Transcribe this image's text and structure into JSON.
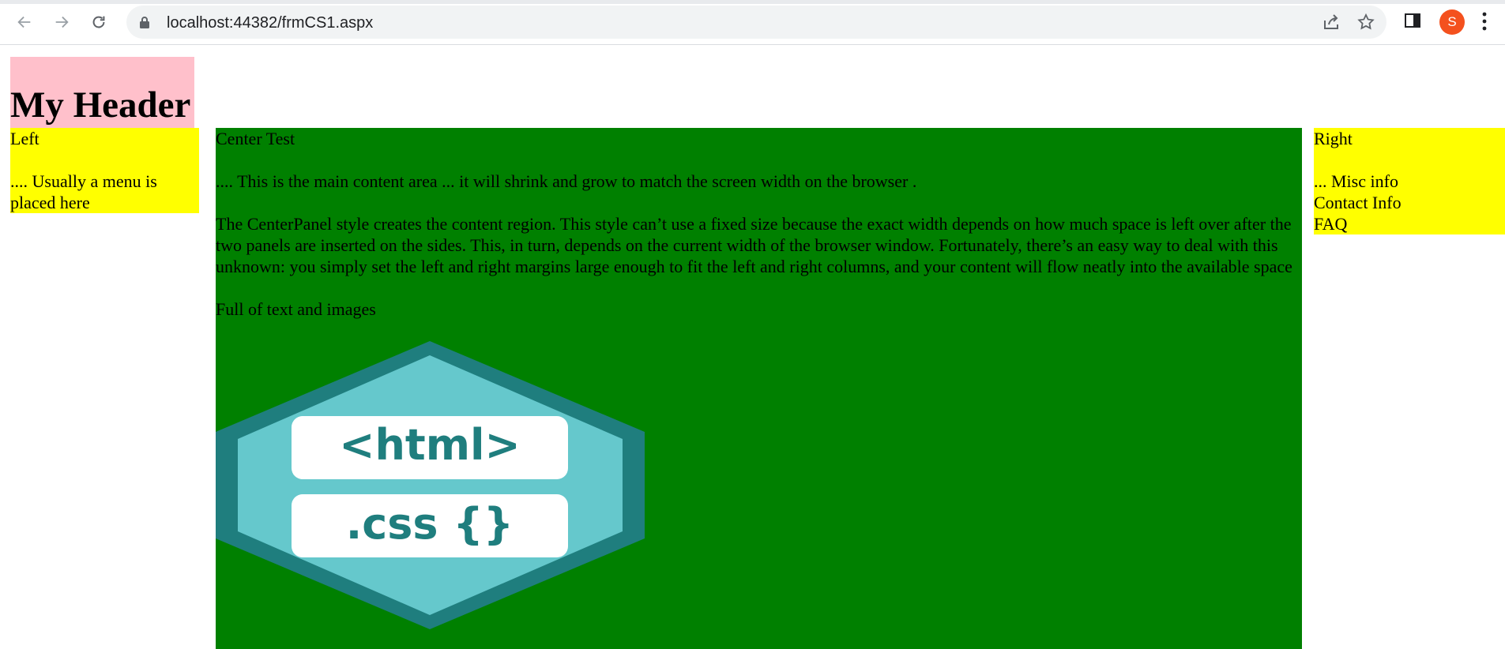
{
  "browser": {
    "url": "localhost:44382/frmCS1.aspx",
    "profile_initial": "S",
    "profile_color": "#f4511e"
  },
  "header": {
    "title": "My Header",
    "background": "#ffc0cb"
  },
  "left": {
    "title": "Left",
    "text": ".... Usually a menu is placed here",
    "background": "#ffff00"
  },
  "center": {
    "title": "Center Test",
    "paragraphs": [
      ".... This is the main content area ... it will shrink and grow to match the screen width on the browser .",
      "The CenterPanel  style creates the content region. This style can’t use a fixed size because the exact width depends on how much space is left over after the two panels are inserted on the sides. This, in turn, depends on the current width of the browser window. Fortunately, there’s an easy way to deal with this unknown: you simply set the left and right margins large enough to fit the left and right columns, and your content will flow neatly into the available space",
      "Full of text and images"
    ],
    "background": "#008000",
    "logo": {
      "line1": "<html>",
      "line2": ".css {}"
    }
  },
  "right": {
    "title": "Right",
    "items": [
      "... Misc info",
      "Contact Info",
      "FAQ"
    ],
    "background": "#ffff00"
  }
}
